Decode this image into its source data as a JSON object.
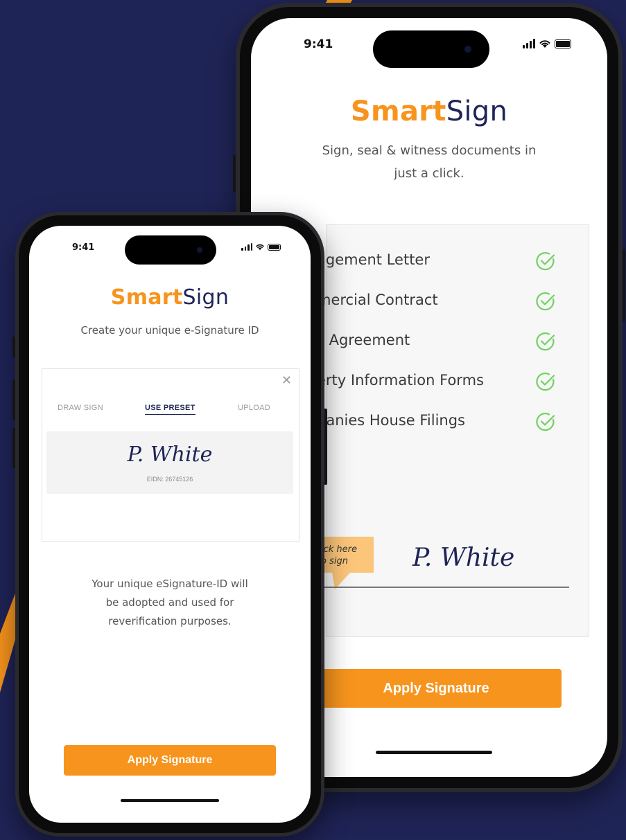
{
  "colors": {
    "background": "#1f2457",
    "accent": "#f7941d",
    "navy": "#1f2457",
    "check": "#6fd25e"
  },
  "back_phone": {
    "status": {
      "time": "9:41"
    },
    "brand": {
      "smart": "Smart",
      "sign": "Sign"
    },
    "tagline_lines": [
      "Sign, seal & witness documents in",
      "just a click."
    ],
    "documents": [
      {
        "name": "agement Letter",
        "icon": "check-circle-icon"
      },
      {
        "name": "mercial Contract",
        "icon": "check-circle-icon"
      },
      {
        "name": "s Agreement",
        "icon": "check-circle-icon"
      },
      {
        "name": "erty Information Forms",
        "icon": "check-circle-icon"
      },
      {
        "name": "panies House Filings",
        "icon": "check-circle-icon"
      }
    ],
    "click_tag": [
      "ick here",
      "o sign"
    ],
    "signature": "P. White",
    "apply_label": "Apply Signature"
  },
  "front_phone": {
    "status": {
      "time": "9:41"
    },
    "brand": {
      "smart": "Smart",
      "sign": "Sign"
    },
    "tagline": "Create your unique e-Signature ID",
    "tabs": [
      "DRAW SIGN",
      "USE PRESET",
      "UPLOAD"
    ],
    "active_tab": "USE PRESET",
    "signature": "P. White",
    "eidn": "EIDN: 26745126",
    "note_lines": [
      "Your unique eSignature-ID will",
      "be adopted and used for",
      "reverification purposes."
    ],
    "apply_label": "Apply Signature"
  }
}
